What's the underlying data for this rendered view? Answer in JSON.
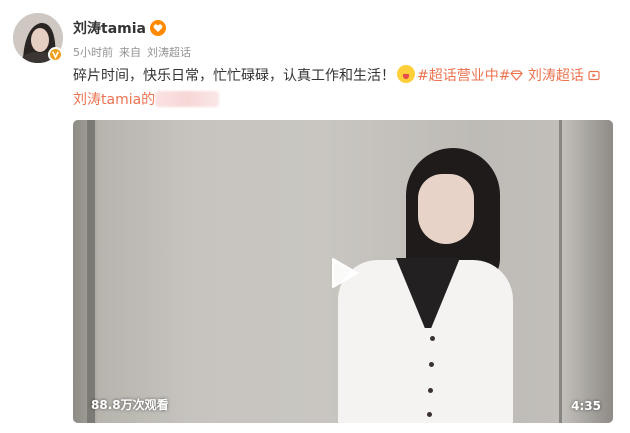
{
  "user": {
    "name": "刘涛tamia",
    "member_icon": "vip-heart-icon",
    "verified_icon": "verified-v-icon",
    "accent_color": "#eb7350"
  },
  "meta": {
    "time": "5小时前",
    "source_prefix": "来自",
    "source": "刘涛超话"
  },
  "post": {
    "text": "碎片时间，快乐日常，忙忙碌碌，认真工作和生活！",
    "emoji": "smile-tongue-emoji",
    "hashtag": "#超话营业中#",
    "supertopic_icon": "diamond-icon",
    "supertopic": "刘涛超话",
    "video_link_icon": "video-link-icon",
    "video_link": "刘涛tamia的"
  },
  "video": {
    "view_count": "88.8万次观看",
    "duration": "4:35",
    "play_icon": "play-icon"
  }
}
